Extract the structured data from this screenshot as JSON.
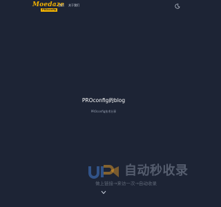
{
  "header": {
    "logo_text": "Moedaze",
    "logo_sub": "PROconfig",
    "nav": [
      {
        "label": "首页"
      },
      {
        "label": "关于我们"
      }
    ],
    "theme_icon": "moon-icon"
  },
  "hero": {
    "title": "PROconfig的blog",
    "subtitle": "PROconfig技术分享"
  },
  "watermark": {
    "main": "自动秒收录",
    "sub": "做上链接→来访一次→自动收录",
    "icon": "jr-logo-icon"
  },
  "scroll_icon": "chevron-down-icon",
  "colors": {
    "background": "#1d2435",
    "logo_accent": "#f5b400",
    "watermark_blue": "#3b7dd8"
  }
}
